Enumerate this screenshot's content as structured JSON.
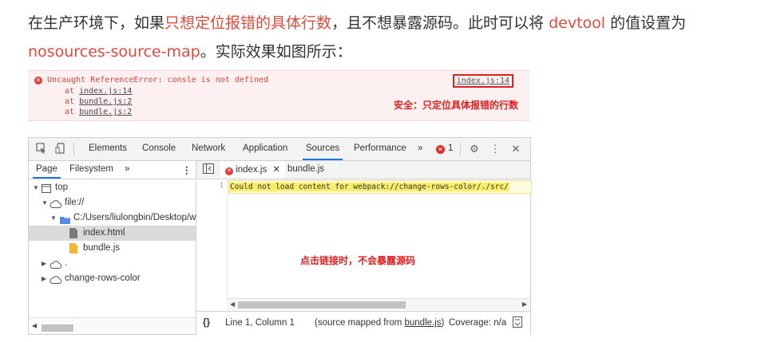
{
  "paragraph": {
    "line1_a": "在生产环境下，如果",
    "line1_red": "只想定位报错的具体行数",
    "line1_b": "，且不想暴露源码。此时可以将 ",
    "line1_devtool": "devtool",
    "line1_c": " 的值设置为",
    "line2_red": "nosources-source-map",
    "line2_b": "。实际效果如图所示："
  },
  "console_error": {
    "message": "Uncaught ReferenceError: consle is not defined",
    "stack": [
      {
        "prefix": "at ",
        "link": "index.js:14"
      },
      {
        "prefix": "at ",
        "link": "bundle.js:2"
      },
      {
        "prefix": "at ",
        "link": "bundle.js:2"
      }
    ],
    "source_link": "index.js:14",
    "annotation": "安全：只定位具体报错的行数"
  },
  "devtools": {
    "tabs": [
      "Elements",
      "Console",
      "Network",
      "Application",
      "Sources",
      "Performance"
    ],
    "active_tab": "Sources",
    "more": "»",
    "error_count": "1",
    "left_tabs": [
      "Page",
      "Filesystem"
    ],
    "tree": {
      "top": "top",
      "file": "file://",
      "folder": "C:/Users/liulongbin/Desktop/w",
      "index_html": "index.html",
      "bundle_js": "bundle.js",
      "dot": ".",
      "change": "change-rows-color"
    },
    "editor_tabs": [
      "index.js",
      "bundle.js"
    ],
    "line_number": "1",
    "code_line": "Could not load content for webpack://change-rows-color/./src/",
    "annotation": "点击链接时，不会暴露源码",
    "status": {
      "braces": "{}",
      "position": "Line 1, Column 1",
      "mapped_prefix": "(source mapped from ",
      "mapped_link": "bundle.js",
      "mapped_suffix": ")",
      "coverage": "Coverage: n/a"
    }
  },
  "colors": {
    "accent": "#e04a3c",
    "tab_underline": "#1a73e8",
    "code_highlight": "#f8ee6a"
  }
}
